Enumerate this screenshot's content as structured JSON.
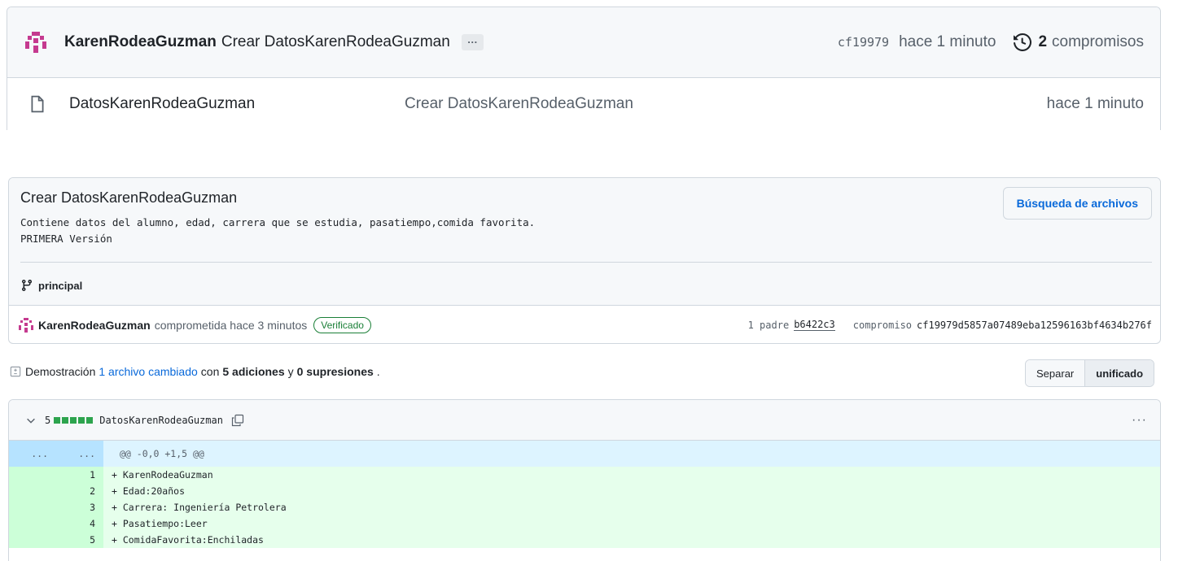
{
  "repo": {
    "author": "KarenRodeaGuzman",
    "last_commit_message": "Crear DatosKarenRodeaGuzman",
    "ellipsis": "…",
    "short_sha": "cf19979",
    "time_ago": "hace 1 minuto",
    "commits_count": "2",
    "commits_label": "compromisos",
    "files": [
      {
        "name": "DatosKarenRodeaGuzman",
        "message": "Crear DatosKarenRodeaGuzman",
        "time": "hace 1 minuto"
      }
    ]
  },
  "commit": {
    "title": "Crear DatosKarenRodeaGuzman",
    "description": "Contiene datos del alumno, edad, carrera que se estudia, pasatiempo,comida favorita.\nPRIMERA Versión",
    "browse_button": "Búsqueda de archivos",
    "branch": "principal",
    "author": "KarenRodeaGuzman",
    "action_text": "comprometida hace 3 minutos",
    "verified": "Verificado",
    "parent_label": "1 padre",
    "parent_sha": "b6422c3",
    "commit_label": "compromiso",
    "full_sha": "cf19979d5857a07489eba12596163bf4634b276f"
  },
  "summary": {
    "prefix": "Demostración",
    "files_changed": "1 archivo cambiado",
    "with": "con",
    "additions": "5 adiciones",
    "and": "y",
    "deletions": "0 supresiones",
    "period": ".",
    "split_label": "Separar",
    "unified_label": "unificado"
  },
  "diff": {
    "count": "5",
    "filename": "DatosKarenRodeaGuzman",
    "more": "···",
    "hunk_left": "...",
    "hunk_right": "...",
    "hunk_header": "@@ -0,0 +1,5 @@",
    "lines": [
      {
        "num": "1",
        "text": "+ KarenRodeaGuzman"
      },
      {
        "num": "2",
        "text": "+ Edad:20años"
      },
      {
        "num": "3",
        "text": "+ Carrera: Ingeniería Petrolera"
      },
      {
        "num": "4",
        "text": "+ Pasatiempo:Leer"
      },
      {
        "num": "5",
        "text": "+ ComidaFavorita:Enchiladas"
      }
    ]
  },
  "colors": {
    "accent": "#0969da",
    "add_bg": "#e6ffec",
    "add_num_bg": "#ccffd8",
    "hunk_bg": "#ddf4ff",
    "avatar": "#c53a8f",
    "verified": "#1a7f37"
  }
}
